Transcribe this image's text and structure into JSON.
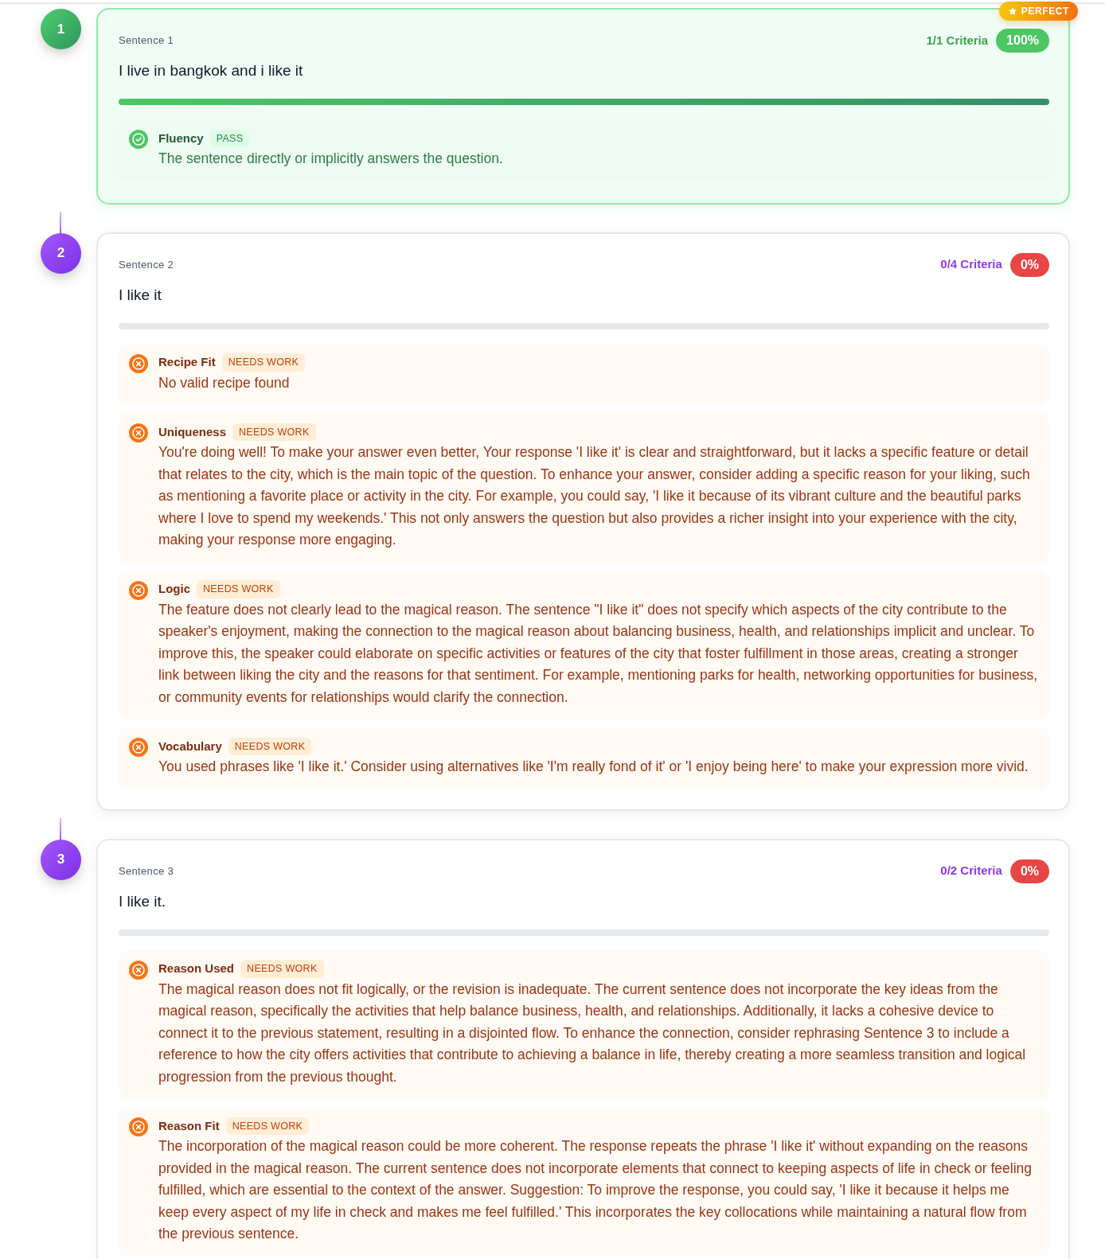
{
  "sentences": [
    {
      "number": "1",
      "label": "Sentence 1",
      "text": "I live in bangkok and i like it",
      "kind": "perfect",
      "ribbon": "PERFECT",
      "criteria_count": "1/1 Criteria",
      "score": "100%",
      "level": 1,
      "criteria": [
        {
          "name": "Fluency",
          "result": "PASS",
          "passed": true,
          "feedback": "The sentence directly or implicitly answers the question."
        }
      ]
    },
    {
      "number": "2",
      "label": "Sentence 2",
      "text": "I like it",
      "kind": "needs_work",
      "criteria_count": "0/4 Criteria",
      "score": "0%",
      "level": 0,
      "criteria": [
        {
          "name": "Recipe Fit",
          "result": "NEEDS WORK",
          "passed": false,
          "feedback": "No valid recipe found"
        },
        {
          "name": "Uniqueness",
          "result": "NEEDS WORK",
          "passed": false,
          "feedback": "You're doing well! To make your answer even better, Your response 'I like it' is clear and straightforward, but it lacks a specific feature or detail that relates to the city, which is the main topic of the question. To enhance your answer, consider adding a specific reason for your liking, such as mentioning a favorite place or activity in the city. For example, you could say, 'I like it because of its vibrant culture and the beautiful parks where I love to spend my weekends.' This not only answers the question but also provides a richer insight into your experience with the city, making your response more engaging."
        },
        {
          "name": "Logic",
          "result": "NEEDS WORK",
          "passed": false,
          "feedback": "The feature does not clearly lead to the magical reason. The sentence \"I like it\" does not specify which aspects of the city contribute to the speaker's enjoyment, making the connection to the magical reason about balancing business, health, and relationships implicit and unclear. To improve this, the speaker could elaborate on specific activities or features of the city that foster fulfillment in those areas, creating a stronger link between liking the city and the reasons for that sentiment. For example, mentioning parks for health, networking opportunities for business, or community events for relationships would clarify the connection."
        },
        {
          "name": "Vocabulary",
          "result": "NEEDS WORK",
          "passed": false,
          "feedback": "You used phrases like 'I like it.' Consider using alternatives like 'I'm really fond of it' or 'I enjoy being here' to make your expression more vivid."
        }
      ]
    },
    {
      "number": "3",
      "label": "Sentence 3",
      "text": "I like it.",
      "kind": "needs_work",
      "criteria_count": "0/2 Criteria",
      "score": "0%",
      "level": 0,
      "criteria": [
        {
          "name": "Reason Used",
          "result": "NEEDS WORK",
          "passed": false,
          "feedback": "The magical reason does not fit logically, or the revision is inadequate. The current sentence does not incorporate the key ideas from the magical reason, specifically the activities that help balance business, health, and relationships. Additionally, it lacks a cohesive device to connect it to the previous statement, resulting in a disjointed flow. To enhance the connection, consider rephrasing Sentence 3 to include a reference to how the city offers activities that contribute to achieving a balance in life, thereby creating a more seamless transition and logical progression from the previous thought."
        },
        {
          "name": "Reason Fit",
          "result": "NEEDS WORK",
          "passed": false,
          "feedback": "The incorporation of the magical reason could be more coherent. The response repeats the phrase 'I like it' without expanding on the reasons provided in the magical reason. The current sentence does not incorporate elements that connect to keeping aspects of life in check or feeling fulfilled, which are essential to the context of the answer. Suggestion: To improve the response, you could say, 'I like it because it helps me keep every aspect of my life in check and makes me feel fulfilled.' This incorporates the key collocations while maintaining a natural flow from the previous sentence."
        }
      ]
    }
  ]
}
